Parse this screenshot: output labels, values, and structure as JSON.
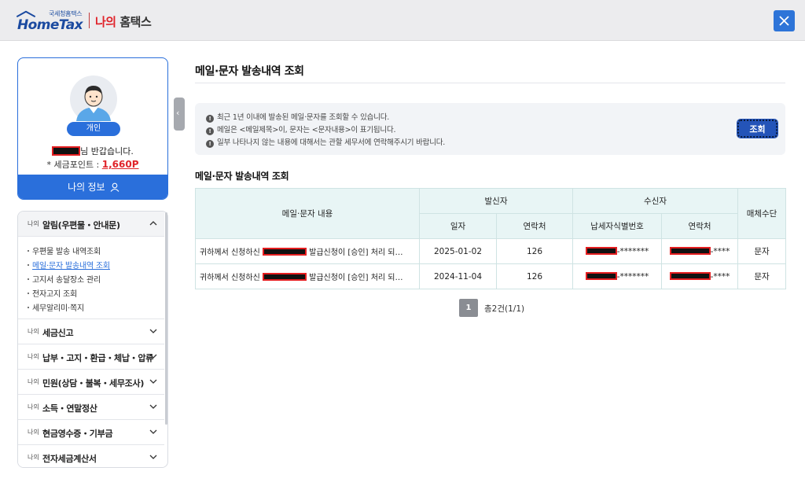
{
  "header": {
    "logo_small": "국세청홈택스",
    "logo_big": "HomeTax",
    "title_red": "나의",
    "title_dark": "홈택스"
  },
  "profile": {
    "badge": "개인",
    "greeting": "님 반갑습니다.",
    "points_label": "* 세금포인트 : ",
    "points_value": "1,660P",
    "my_info": "나의 정보"
  },
  "menu": {
    "prefix": "나의",
    "sections": [
      {
        "label": "알림(우편물・안내문)",
        "open": true
      },
      {
        "label": "세금신고"
      },
      {
        "label": "납부・고지・환급・체납・압류"
      },
      {
        "label": "민원(상담・불복・세무조사)"
      },
      {
        "label": "소득・연말정산"
      },
      {
        "label": "현금영수증・기부금"
      },
      {
        "label": "전자세금계산서"
      }
    ],
    "sub_items": [
      "우편물 발송 내역조회",
      "메일·문자 발송내역 조회",
      "고지서 송달장소 관리",
      "전자고지 조회",
      "세무알리미·쪽지"
    ]
  },
  "main": {
    "title": "메일·문자 발송내역 조회",
    "notices": [
      "최근 1년 이내에 발송된 메일·문자를 조회할 수 있습니다.",
      "메일은 <메일제목>이, 문자는 <문자내용>이 표기됩니다.",
      "일부 나타나지 않는 내용에 대해서는 관할 세무서에 연락해주시기 바랍니다."
    ],
    "query_button": "조회",
    "table_title": "메일·문자 발송내역 조회",
    "headers": {
      "content": "메일·문자 내용",
      "sender": "발신자",
      "sender_date": "일자",
      "sender_contact": "연락처",
      "receiver": "수신자",
      "receiver_id": "납세자식별번호",
      "receiver_contact": "연락처",
      "media": "매체수단"
    },
    "rows": [
      {
        "content_pre": "귀하께서 신청하신 ",
        "content_post": " 발급신청이 [승인] 처리 되…",
        "date": "2025-01-02",
        "sender_contact": "126",
        "receiver_id_mask": "-*******",
        "receiver_contact_mask": "-****",
        "media": "문자"
      },
      {
        "content_pre": "귀하께서 신청하신 ",
        "content_post": " 발급신청이 [승인] 처리 되…",
        "date": "2024-11-04",
        "sender_contact": "126",
        "receiver_id_mask": "-*******",
        "receiver_contact_mask": "-****",
        "media": "문자"
      }
    ],
    "pager": {
      "current": "1",
      "info": "총2건(1/1)"
    }
  },
  "colors": {
    "accent": "#2a6fdb",
    "brand_red": "#e0242b",
    "table_header": "#e8f5f5"
  }
}
